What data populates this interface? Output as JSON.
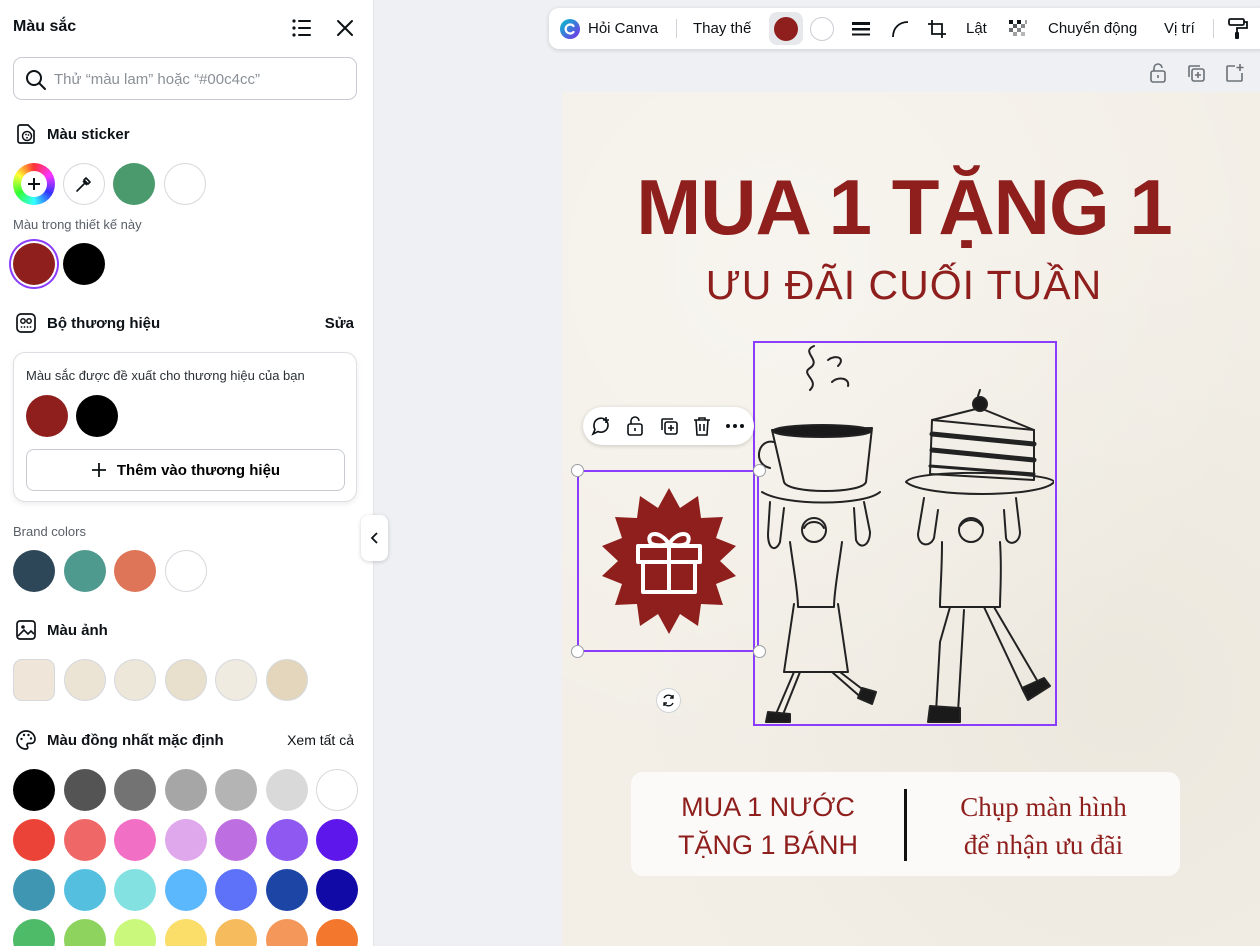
{
  "panel": {
    "title": "Màu sắc",
    "search_placeholder": "Thử “màu lam” hoặc “#00c4cc”",
    "sticker": {
      "title": "Màu sticker",
      "swatches": [
        "#4a9a6e",
        "#ffffff"
      ]
    },
    "design_colors": {
      "label": "Màu trong thiết kế này",
      "swatches": [
        "#8e1f1d",
        "#000000"
      ]
    },
    "brand_kit": {
      "title": "Bộ thương hiệu",
      "edit_label": "Sửa",
      "suggest_text": "Màu sắc được đề xuất cho thương hiệu của bạn",
      "swatches": [
        "#8e1f1d",
        "#000000"
      ],
      "add_button": "Thêm vào thương hiệu"
    },
    "brand_colors": {
      "label": "Brand colors",
      "swatches": [
        "#2d4658",
        "#4e9a8f",
        "#df7558",
        "#ffffff"
      ]
    },
    "photo_colors": {
      "title": "Màu ảnh",
      "swatches": [
        "#efe6d9",
        "#ebe3d4",
        "#ede7da",
        "#e8dfcd",
        "#efebe1",
        "#e3d6bd"
      ]
    },
    "default_colors": {
      "title": "Màu đồng nhất mặc định",
      "see_all": "Xem tất cả",
      "rows": [
        [
          "#000000",
          "#545454",
          "#737373",
          "#a6a6a6",
          "#b4b4b4",
          "#d9d9d9",
          "#ffffff"
        ],
        [
          "#ec4338",
          "#f06767",
          "#f26fc6",
          "#dfa7ec",
          "#bd6ee0",
          "#8e58f1",
          "#5e17eb"
        ],
        [
          "#3f96b3",
          "#55bfe0",
          "#84e1e2",
          "#5cb8fd",
          "#5d72f9",
          "#1c45a6",
          "#120aa6"
        ],
        [
          "#4dbb68",
          "#8ed35e",
          "#c9f87c",
          "#fbdd69",
          "#f5bb5d",
          "#f4975b",
          "#f3772c"
        ]
      ]
    }
  },
  "toolbar": {
    "ask_canva": "Hỏi Canva",
    "replace": "Thay thế",
    "color_selected": "#8e1f1d",
    "color_secondary": "#ffffff",
    "flip": "Lật",
    "animate": "Chuyển động",
    "position": "Vị trí"
  },
  "canvas": {
    "headline": "MUA 1 TẶNG 1",
    "subhead": "ƯU ĐÃI CUỐI TUẦN",
    "offer_left": "MUA 1 NƯỚC\nTẶNG 1 BÁNH",
    "offer_right": "Chụp màn hình\nđể nhận ưu đãi",
    "brand_red": "#8e1f1d"
  }
}
